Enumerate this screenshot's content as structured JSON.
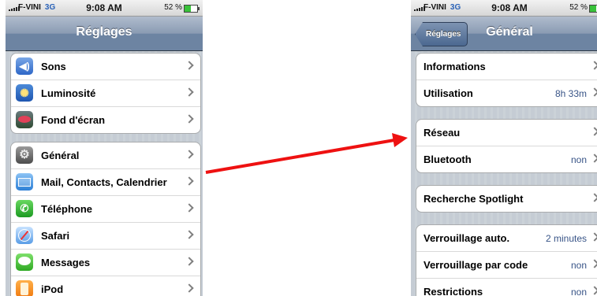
{
  "left_screen": {
    "status": {
      "carrier": "F-VINI",
      "network": "3G",
      "time": "9:08 AM",
      "battery": "52 %",
      "battery_level": 0.52
    },
    "nav_title": "Réglages",
    "group1": [
      {
        "label": "Sons",
        "icon": "speaker-icon"
      },
      {
        "label": "Luminosité",
        "icon": "sun-icon"
      },
      {
        "label": "Fond d'écran",
        "icon": "flower-icon"
      }
    ],
    "group2": [
      {
        "label": "Général",
        "icon": "gear-icon"
      },
      {
        "label": "Mail, Contacts, Calendrier",
        "icon": "envelope-icon"
      },
      {
        "label": "Téléphone",
        "icon": "phone-icon"
      },
      {
        "label": "Safari",
        "icon": "compass-icon"
      },
      {
        "label": "Messages",
        "icon": "speech-bubble-icon"
      },
      {
        "label": "iPod",
        "icon": "ipod-icon"
      }
    ],
    "icon_glyphs": {
      "sound": "◀)",
      "bright": "✺",
      "general": "⚙",
      "phone": "✆"
    }
  },
  "right_screen": {
    "status": {
      "carrier": "F-VINI",
      "network": "3G",
      "time": "9:08 AM",
      "battery": "52 %",
      "battery_level": 0.52
    },
    "back_label": "Réglages",
    "nav_title": "Général",
    "group1": [
      {
        "label": "Informations",
        "value": ""
      },
      {
        "label": "Utilisation",
        "value": "8h 33m"
      }
    ],
    "group2": [
      {
        "label": "Réseau",
        "value": ""
      },
      {
        "label": "Bluetooth",
        "value": "non"
      }
    ],
    "group3": [
      {
        "label": "Recherche Spotlight",
        "value": ""
      }
    ],
    "group4": [
      {
        "label": "Verrouillage auto.",
        "value": "2 minutes"
      },
      {
        "label": "Verrouillage par code",
        "value": "non"
      },
      {
        "label": "Restrictions",
        "value": "non"
      }
    ]
  },
  "colors": {
    "arrow": "#ee1111",
    "nav_bar": "#6d84a2",
    "value_text": "#385487"
  }
}
